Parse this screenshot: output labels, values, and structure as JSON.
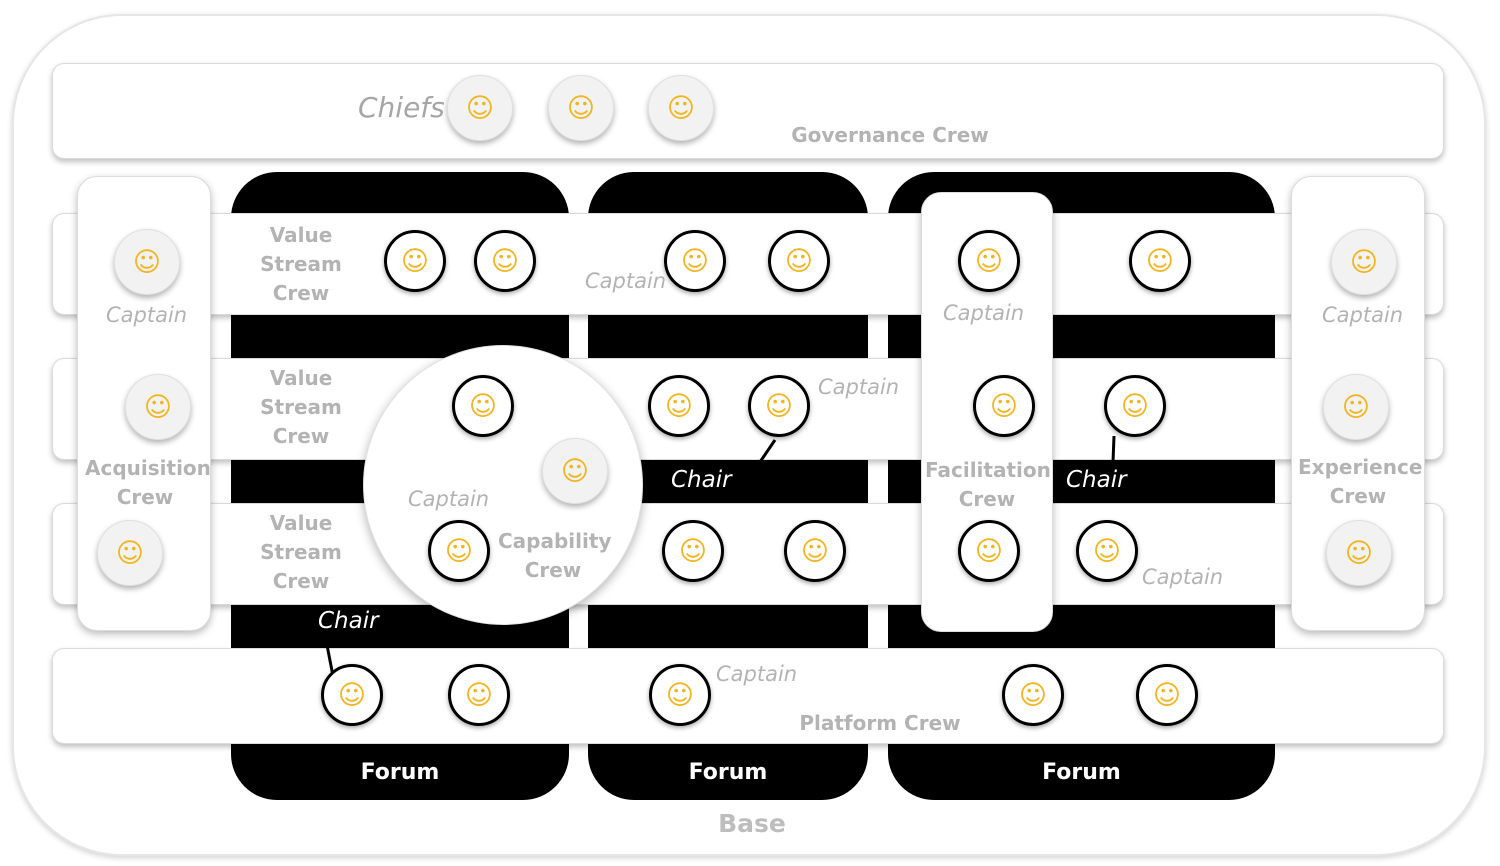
{
  "labels": {
    "chiefs": "Chiefs",
    "governance_crew": "Governance Crew",
    "value_stream_crew_1": "Value Stream Crew",
    "value_stream_crew_2": "Value Stream Crew",
    "value_stream_crew_3": "Value Stream Crew",
    "acquisition_crew": "Acquisition Crew",
    "experience_crew": "Experience Crew",
    "facilitation_crew": "Facilitation Crew",
    "capability_crew": "Capability Crew",
    "platform_crew": "Platform Crew",
    "forum_1": "Forum",
    "forum_2": "Forum",
    "forum_3": "Forum",
    "base": "Base",
    "captain": "Captain",
    "chair": "Chair"
  },
  "faces": {
    "chief_1": "☺",
    "chief_2": "☺",
    "chief_3": "☺",
    "acq_1": "☺",
    "acq_2": "☺",
    "acq_3": "☺",
    "exp_1": "☺",
    "exp_2": "☺",
    "exp_3": "☺",
    "vs1_1": "☺",
    "vs1_2": "☺",
    "vs1_3": "☺",
    "vs1_4": "☺",
    "vs1_5": "☺",
    "vs1_6": "☺",
    "vs2_1": "☺",
    "vs2_2": "☺",
    "vs2_3": "☺",
    "vs2_4": "☺",
    "vs2_5": "☺",
    "vs2_6": "☺",
    "vs3_1": "☺",
    "vs3_2": "☺",
    "vs3_3": "☺",
    "vs3_4": "☺",
    "plat_1": "☺",
    "plat_2": "☺",
    "plat_3": "☺",
    "plat_4": "☺",
    "plat_5": "☺"
  },
  "colors": {
    "forum_black": "#000000",
    "label_grey": "#b3b3b3",
    "face_yellow": "#f2b520"
  }
}
